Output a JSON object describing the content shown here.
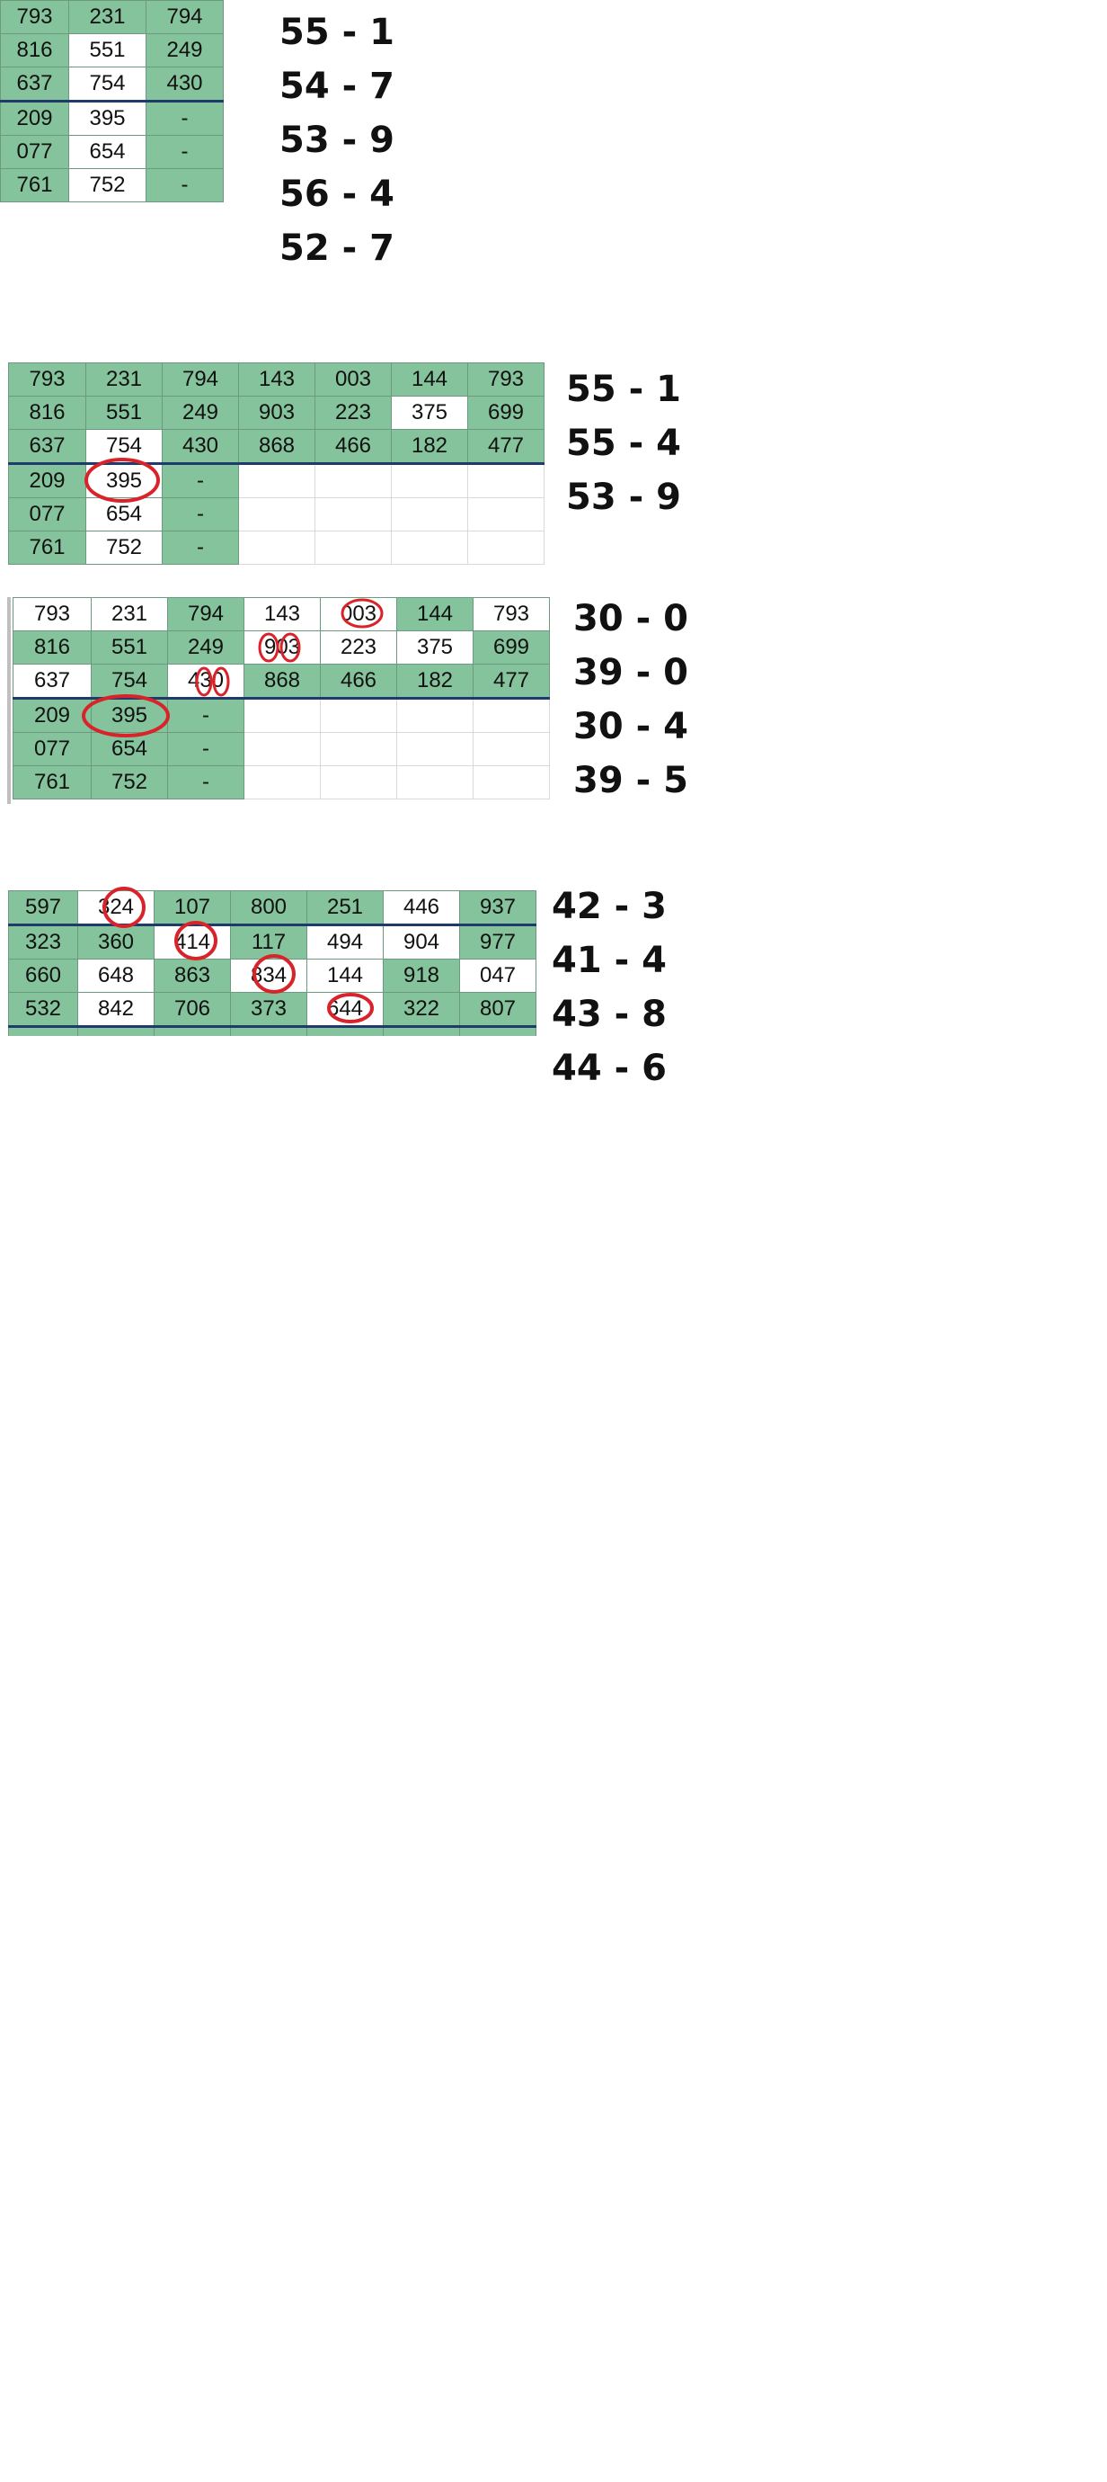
{
  "colors": {
    "green": "#84c39c",
    "white": "#ffffff",
    "circle": "#d9232a",
    "thick_border": "#1f3b6b"
  },
  "snippets": [
    {
      "rows": [
        [
          "793",
          "231",
          "794"
        ],
        [
          "816",
          "551",
          "249"
        ],
        [
          "637",
          "754",
          "430"
        ],
        [
          "209",
          "395",
          "-"
        ],
        [
          "077",
          "654",
          "-"
        ],
        [
          "761",
          "752",
          "-"
        ]
      ],
      "green": [
        [
          1,
          1,
          1
        ],
        [
          1,
          0,
          1
        ],
        [
          1,
          0,
          1
        ],
        [
          1,
          0,
          1
        ],
        [
          1,
          0,
          1
        ],
        [
          1,
          0,
          1
        ]
      ],
      "labels": [
        "55 - 1",
        "54 - 7",
        "53 - 9",
        "56 - 4",
        "52 - 7"
      ]
    },
    {
      "rows": [
        [
          "793",
          "231",
          "794",
          "143",
          "003",
          "144",
          "793"
        ],
        [
          "816",
          "551",
          "249",
          "903",
          "223",
          "375",
          "699"
        ],
        [
          "637",
          "754",
          "430",
          "868",
          "466",
          "182",
          "477"
        ],
        [
          "209",
          "395",
          "-",
          "",
          "",
          "",
          ""
        ],
        [
          "077",
          "654",
          "-",
          "",
          "",
          "",
          ""
        ],
        [
          "761",
          "752",
          "-",
          "",
          "",
          "",
          ""
        ]
      ],
      "green": [
        [
          1,
          1,
          1,
          1,
          1,
          1,
          1
        ],
        [
          1,
          1,
          1,
          1,
          1,
          0,
          1
        ],
        [
          1,
          0,
          1,
          1,
          1,
          1,
          1
        ],
        [
          1,
          0,
          1,
          0,
          0,
          0,
          0
        ],
        [
          1,
          0,
          1,
          0,
          0,
          0,
          0
        ],
        [
          1,
          0,
          1,
          0,
          0,
          0,
          0
        ]
      ],
      "labels": [
        "55 - 1",
        "55 - 4",
        "53 - 9"
      ]
    },
    {
      "rows": [
        [
          "793",
          "231",
          "794",
          "143",
          "003",
          "144",
          "793"
        ],
        [
          "816",
          "551",
          "249",
          "903",
          "223",
          "375",
          "699"
        ],
        [
          "637",
          "754",
          "430",
          "868",
          "466",
          "182",
          "477"
        ],
        [
          "209",
          "395",
          "-",
          "",
          "",
          "",
          ""
        ],
        [
          "077",
          "654",
          "-",
          "",
          "",
          "",
          ""
        ],
        [
          "761",
          "752",
          "-",
          "",
          "",
          "",
          ""
        ]
      ],
      "green": [
        [
          0,
          0,
          1,
          0,
          0,
          1,
          0
        ],
        [
          1,
          1,
          1,
          0,
          0,
          0,
          1
        ],
        [
          0,
          1,
          0,
          1,
          1,
          1,
          1
        ],
        [
          1,
          1,
          1,
          0,
          0,
          0,
          0
        ],
        [
          1,
          1,
          1,
          0,
          0,
          0,
          0
        ],
        [
          1,
          1,
          1,
          0,
          0,
          0,
          0
        ]
      ],
      "labels": [
        "30 - 0",
        "39 - 0",
        "30 - 4",
        "39 - 5"
      ]
    },
    {
      "rows": [
        [
          "597",
          "324",
          "107",
          "800",
          "251",
          "446",
          "937"
        ],
        [
          "323",
          "360",
          "414",
          "117",
          "494",
          "904",
          "977"
        ],
        [
          "660",
          "648",
          "863",
          "834",
          "144",
          "918",
          "047"
        ],
        [
          "532",
          "842",
          "706",
          "373",
          "644",
          "322",
          "807"
        ]
      ],
      "green": [
        [
          1,
          0,
          1,
          1,
          1,
          0,
          1
        ],
        [
          1,
          1,
          0,
          1,
          0,
          0,
          1
        ],
        [
          1,
          0,
          1,
          0,
          0,
          1,
          0
        ],
        [
          1,
          0,
          1,
          1,
          0,
          1,
          1
        ]
      ],
      "labels": [
        "42 - 3",
        "41 - 4",
        "43 - 8",
        "44 - 6"
      ]
    }
  ]
}
